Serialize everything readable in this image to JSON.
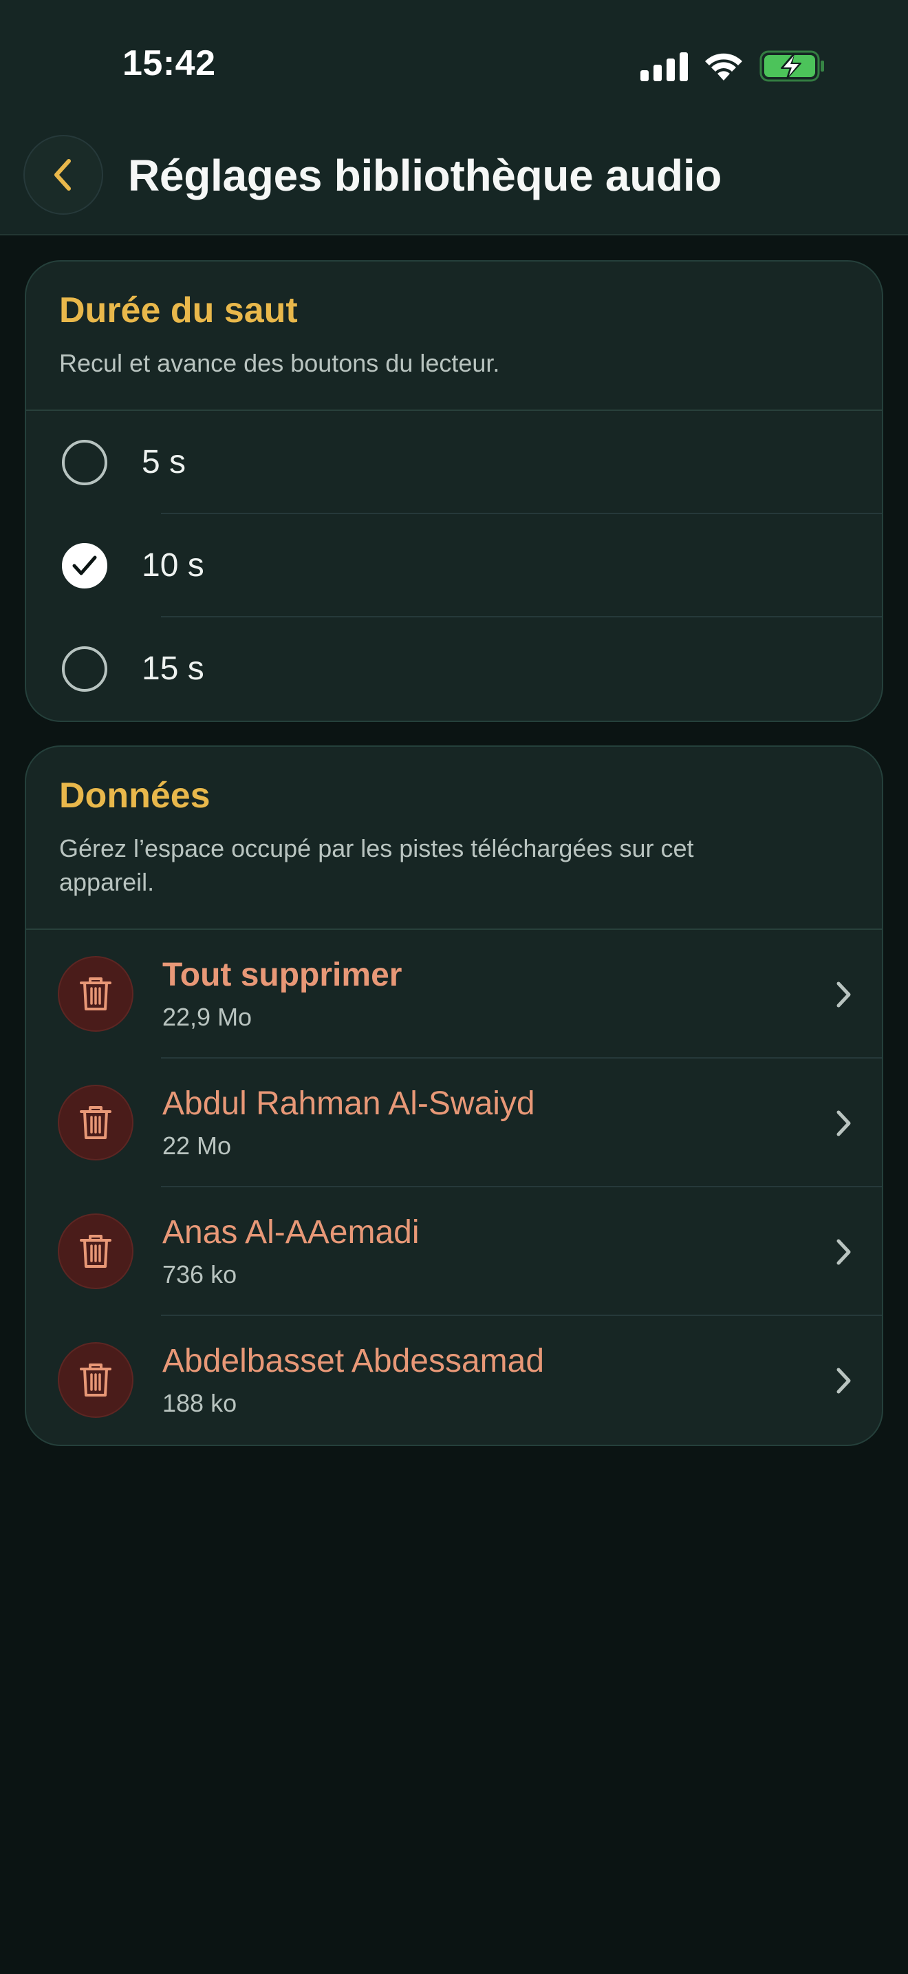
{
  "status": {
    "time": "15:42"
  },
  "header": {
    "title": "Réglages bibliothèque audio",
    "back_icon": "chevron-left-icon"
  },
  "colors": {
    "accent": "#e9b84b",
    "danger_text": "#e89877",
    "background": "#0b1413",
    "card": "#172624",
    "battery": "#4cc35a"
  },
  "skip": {
    "title": "Durée du saut",
    "subtitle": "Recul et avance des boutons du lecteur.",
    "selected": "10 s",
    "options": [
      {
        "label": "5 s",
        "checked": false
      },
      {
        "label": "10 s",
        "checked": true
      },
      {
        "label": "15 s",
        "checked": false
      }
    ]
  },
  "data": {
    "title": "Données",
    "subtitle": "Gérez l’espace occupé par les pistes téléchargées sur cet appareil.",
    "items": [
      {
        "title": "Tout supprimer",
        "size": "22,9 Mo",
        "icon": "trash-icon"
      },
      {
        "title": "Abdul Rahman Al-Swaiyd",
        "size": "22 Mo",
        "icon": "trash-icon"
      },
      {
        "title": "Anas Al-AAemadi",
        "size": "736 ko",
        "icon": "trash-icon"
      },
      {
        "title": "Abdelbasset Abdessamad",
        "size": "188 ko",
        "icon": "trash-icon"
      }
    ]
  }
}
